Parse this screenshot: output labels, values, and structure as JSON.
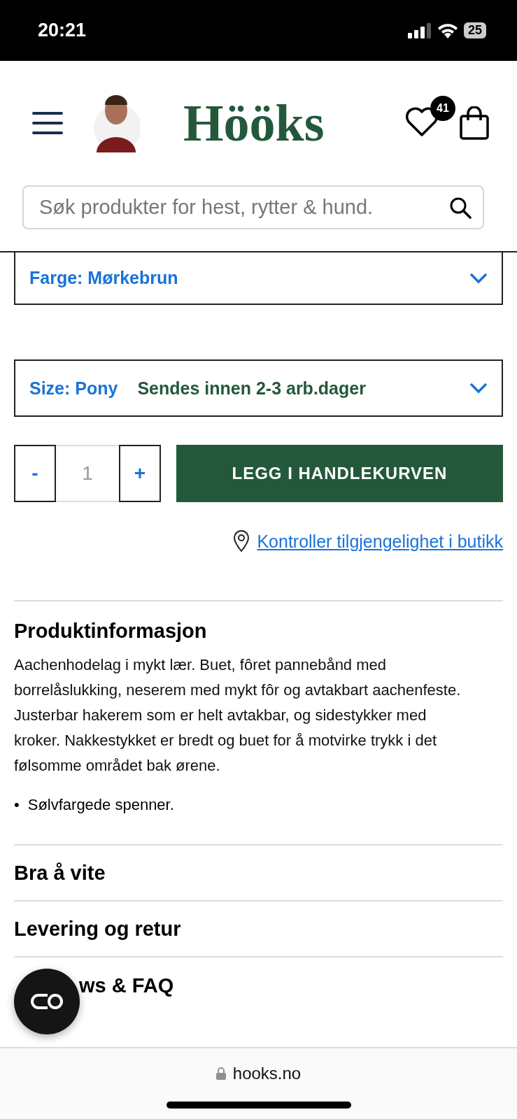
{
  "status_bar": {
    "time": "20:21",
    "battery": "25"
  },
  "header": {
    "logo": "Hööks",
    "wishlist_count": "41",
    "search": {
      "placeholder": "Søk produkter for hest, rytter & hund."
    }
  },
  "options": [
    {
      "label": "Farge: Mørkebrun"
    },
    {
      "label": "Size: Pony",
      "note": "Sendes innen 2-3 arb.dager"
    }
  ],
  "quantity": {
    "minus": "-",
    "value": "1",
    "plus": "+"
  },
  "add_to_cart": "LEGG I HANDLEKURVEN",
  "store_link": "Kontroller tilgjengelighet i butikk",
  "product_info": {
    "title": "Produktinformasjon",
    "text": "Aachenhodelag i mykt lær. Buet, fôret pannebånd med borrelåslukking, neserem med mykt fôr og avtakbart aachenfeste. Justerbar hakerem som er helt avtakbar, og sidestykker med kroker. Nakkestykket er bredt og buet for å motvirke trykk i det følsomme området bak ørene.",
    "bullets": [
      {
        "marker": "•",
        "text": "Sølvfargede spenner."
      }
    ]
  },
  "sections": [
    "Bra å vite",
    "Levering og retur",
    "ws & FAQ"
  ],
  "browser": {
    "url": "hooks.no"
  }
}
